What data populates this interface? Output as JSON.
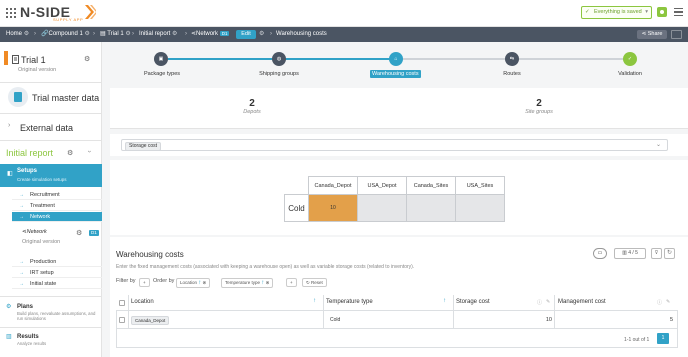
{
  "app": {
    "logo": "N-SIDE",
    "logo_sub": "SUPPLY APP",
    "saved_status": "Everything is saved"
  },
  "breadcrumb": {
    "home": "Home",
    "compound": "Compound 1",
    "trial": "Trial 1",
    "report": "Initial report",
    "network": "Network",
    "network_badge": "D1",
    "edit": "Edit",
    "current": "Warehousing costs",
    "share": "Share"
  },
  "sidebar": {
    "trial_title": "Trial 1",
    "trial_sub": "Original version",
    "master_data": "Trial master data",
    "external_data": "External data",
    "initial_report": "Initial report",
    "setups_title": "Setups",
    "setups_sub": "Create simulation setups",
    "items": [
      {
        "label": "Recruitment"
      },
      {
        "label": "Treatment"
      },
      {
        "label": "Network"
      }
    ],
    "network_sub_title": "Network",
    "network_sub_badge": "D1",
    "network_sub_version": "Original version",
    "items2": [
      {
        "label": "Production"
      },
      {
        "label": "IRT setup"
      },
      {
        "label": "Initial state"
      }
    ],
    "plans_title": "Plans",
    "plans_sub": "Build plans, reevaluate assumptions, and run simulations",
    "results_title": "Results",
    "results_sub": "Analyze results"
  },
  "stepper": {
    "steps": [
      {
        "label": "Package types"
      },
      {
        "label": "Shipping groups"
      },
      {
        "label": "Warehousing costs"
      },
      {
        "label": "Routes"
      },
      {
        "label": "Validation"
      }
    ]
  },
  "summary": {
    "depots_count": "2",
    "depots_label": "Depots",
    "sites_count": "2",
    "sites_label": "Site groups"
  },
  "filter": {
    "chip": "Storage cost"
  },
  "matrix": {
    "columns": [
      "Canada_Depot",
      "USA_Depot",
      "Canada_Sites",
      "USA_Sites"
    ],
    "row_label": "Cold",
    "values": [
      "10",
      "",
      "",
      ""
    ]
  },
  "warehousing": {
    "title": "Warehousing costs",
    "description": "Enter the fixed management costs (associated with keeping a warehouse open) as well as variable storage costs (related to inventory).",
    "count": "4 / 5",
    "filter_by": "Filter by",
    "order_by": "Order by",
    "order_location": "Location",
    "order_temp": "Temperature type",
    "reset": "Reset",
    "headers": [
      "Location",
      "Temperature type",
      "Storage cost",
      "Management cost"
    ],
    "rows": [
      {
        "location": "Canada_Depot",
        "temperature": "Cold",
        "storage": "10",
        "management": "5"
      }
    ],
    "pager_text": "1-1 out of 1",
    "page": "1"
  },
  "colors": {
    "accent": "#31a2c7",
    "success": "#8cc63f",
    "dark": "#4b5563",
    "heat": "#e3a04a"
  }
}
